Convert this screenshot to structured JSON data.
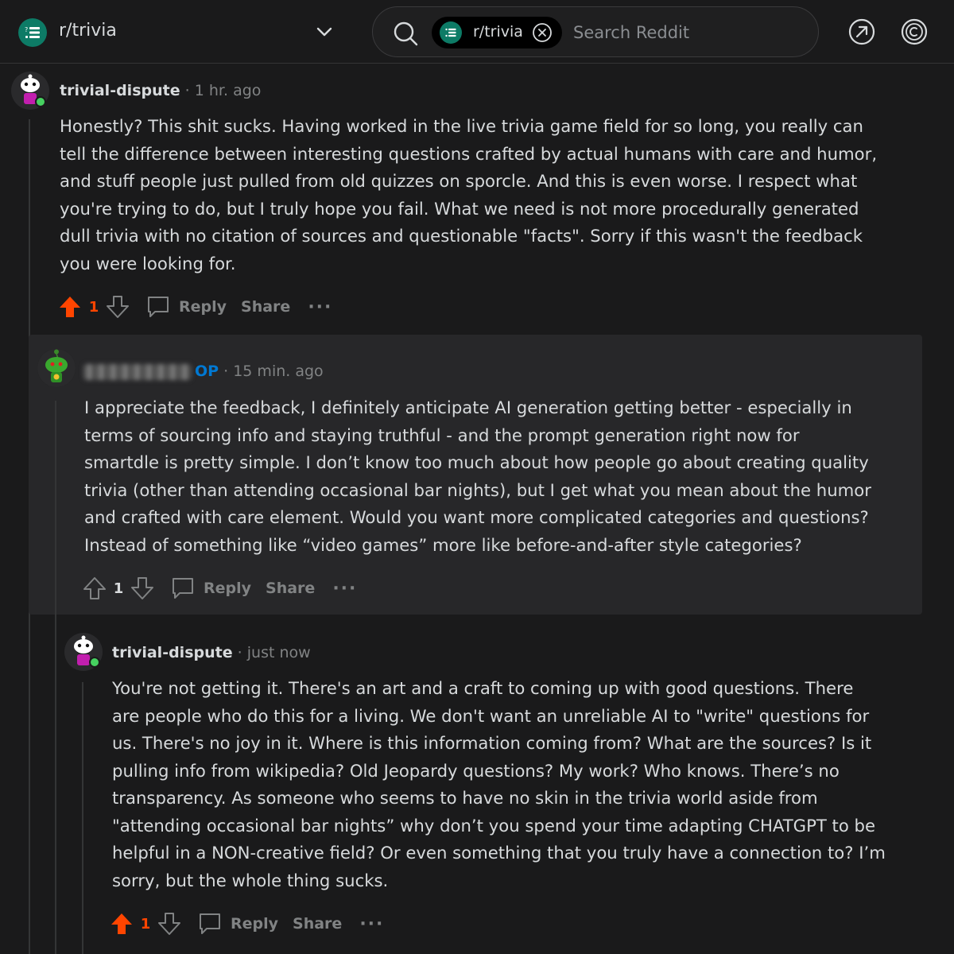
{
  "header": {
    "subreddit": "r/trivia",
    "search_pill": "r/trivia",
    "search_placeholder": "Search Reddit"
  },
  "comments": [
    {
      "author": "trivial-dispute",
      "op_badge": "",
      "time": "1 hr. ago",
      "lines": [
        "Honestly? This shit sucks. Having worked in the live trivia game field for so long, you really can",
        "tell the difference between interesting questions crafted by actual humans with care and humor,",
        "and stuff people just pulled from old quizzes on sporcle. And this is even worse. I respect what",
        "you're trying to do, but I truly hope you fail. What we need is not more procedurally generated",
        "dull trivia with no citation of sources and questionable \"facts\". Sorry if this wasn't the feedback",
        "you were looking for."
      ],
      "score": "1",
      "upvoted": true,
      "reply_label": "Reply",
      "share_label": "Share",
      "more_label": "···"
    },
    {
      "author": "",
      "op_badge": "OP",
      "time": "15 min. ago",
      "lines": [
        "I appreciate the feedback, I definitely anticipate AI generation getting better - especially in",
        "terms of sourcing info and staying truthful - and the prompt generation right now for",
        "smartdle is pretty simple. I don’t know too much about how people go about creating quality",
        "trivia (other than attending occasional bar nights), but I get what you mean about the humor",
        "and crafted with care element. Would you want more complicated categories and questions?",
        "Instead of something like “video games” more like before-and-after style categories?"
      ],
      "score": "1",
      "upvoted": false,
      "reply_label": "Reply",
      "share_label": "Share",
      "more_label": "···"
    },
    {
      "author": "trivial-dispute",
      "op_badge": "",
      "time": "just now",
      "lines": [
        "You're not getting it. There's an art and a craft to coming up with good questions. There",
        "are people who do this for a living. We don't want an unreliable AI to \"write\" questions for",
        "us. There's no joy in it. Where is this information coming from? What are the sources? Is it",
        "pulling info from wikipedia? Old Jeopardy questions? My work? Who knows. There’s no",
        "transparency. As someone who seems to have no skin in the trivia world aside from",
        "\"attending occasional bar nights” why don’t you spend your time adapting CHATGPT to be",
        "helpful in a NON-creative field? Or even something that you truly have a connection to? I’m",
        "sorry, but the whole thing sucks."
      ],
      "score": "1",
      "upvoted": true,
      "reply_label": "Reply",
      "share_label": "Share",
      "more_label": "···"
    }
  ],
  "colors": {
    "background": "#1a1a1b",
    "highlight": "#272729",
    "upvote": "#ff4500",
    "op": "#0079d3",
    "online": "#46d160"
  }
}
